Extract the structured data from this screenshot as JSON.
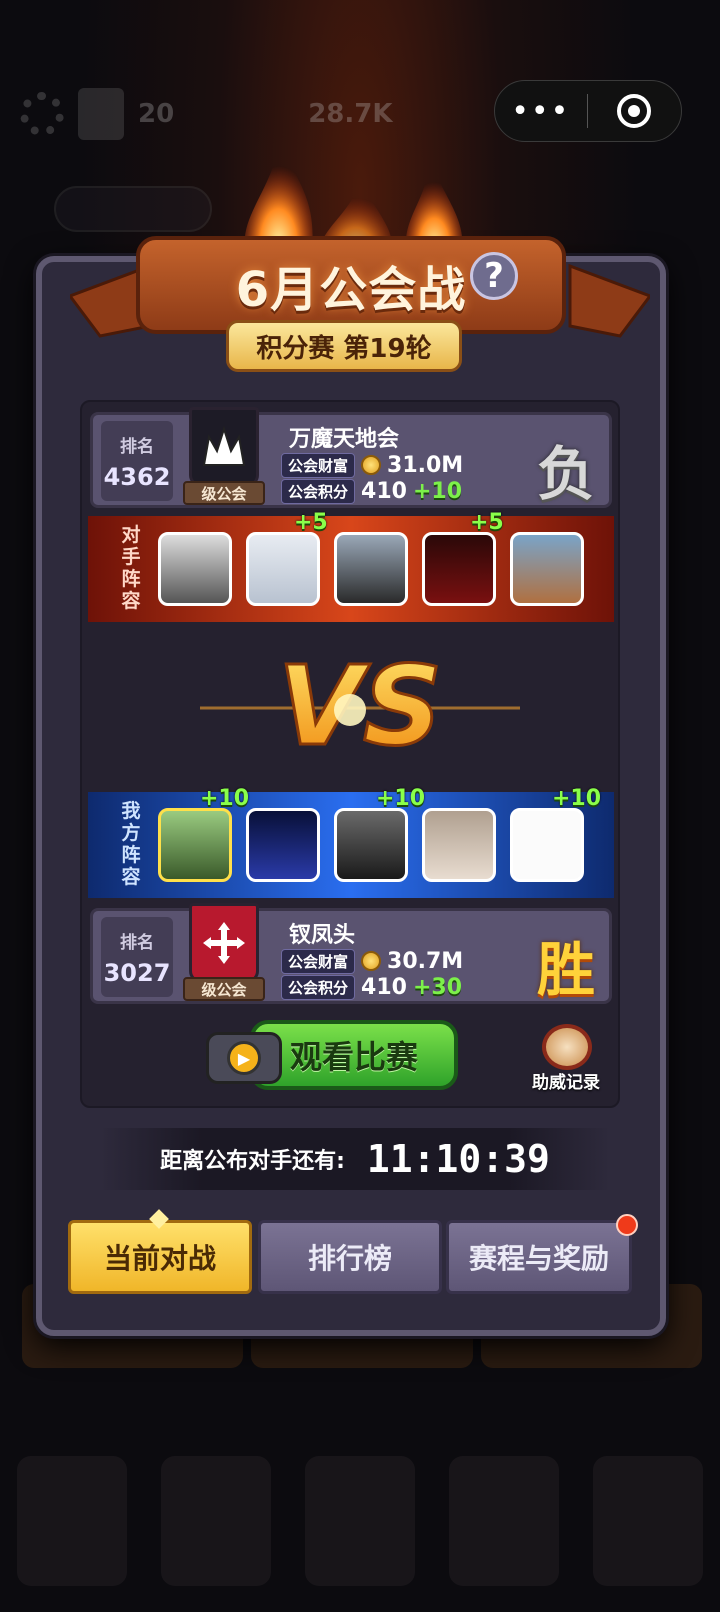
{
  "background": {
    "stat_1": "20",
    "stat_2": "28.7K",
    "accent_color": "#f0b629"
  },
  "event": {
    "title": "6月公会战",
    "help_label": "?",
    "round_text": "积分赛 第19轮"
  },
  "opponent_guild": {
    "rank_label": "排名",
    "rank": "4362",
    "level_tag": "级公会",
    "name": "万魔天地会",
    "wealth_label": "公会财富",
    "wealth": "31.0M",
    "points_label": "公会积分",
    "points": "410",
    "points_gain": "+10",
    "result": "负"
  },
  "opponent_lineup": {
    "label": "对手阵容",
    "members": [
      {
        "plus": ""
      },
      {
        "plus": "+5"
      },
      {
        "plus": ""
      },
      {
        "plus": "+5"
      },
      {
        "plus": ""
      }
    ]
  },
  "vs_text": "VS",
  "my_lineup": {
    "label": "我方阵容",
    "members": [
      {
        "plus": "+10"
      },
      {
        "plus": ""
      },
      {
        "plus": "+10"
      },
      {
        "plus": ""
      },
      {
        "plus": "+10"
      }
    ]
  },
  "my_guild": {
    "rank_label": "排名",
    "rank": "3027",
    "level_tag": "级公会",
    "name": "钗凤头",
    "wealth_label": "公会财富",
    "wealth": "30.7M",
    "points_label": "公会积分",
    "points": "410",
    "points_gain": "+30",
    "result": "胜"
  },
  "actions": {
    "watch_label": "观看比赛",
    "cheer_record_label": "助威记录"
  },
  "countdown": {
    "label": "距离公布对手还有:",
    "time": "11:10:39"
  },
  "tabs": [
    {
      "label": "当前对战"
    },
    {
      "label": "排行榜"
    },
    {
      "label": "赛程与奖励"
    }
  ]
}
